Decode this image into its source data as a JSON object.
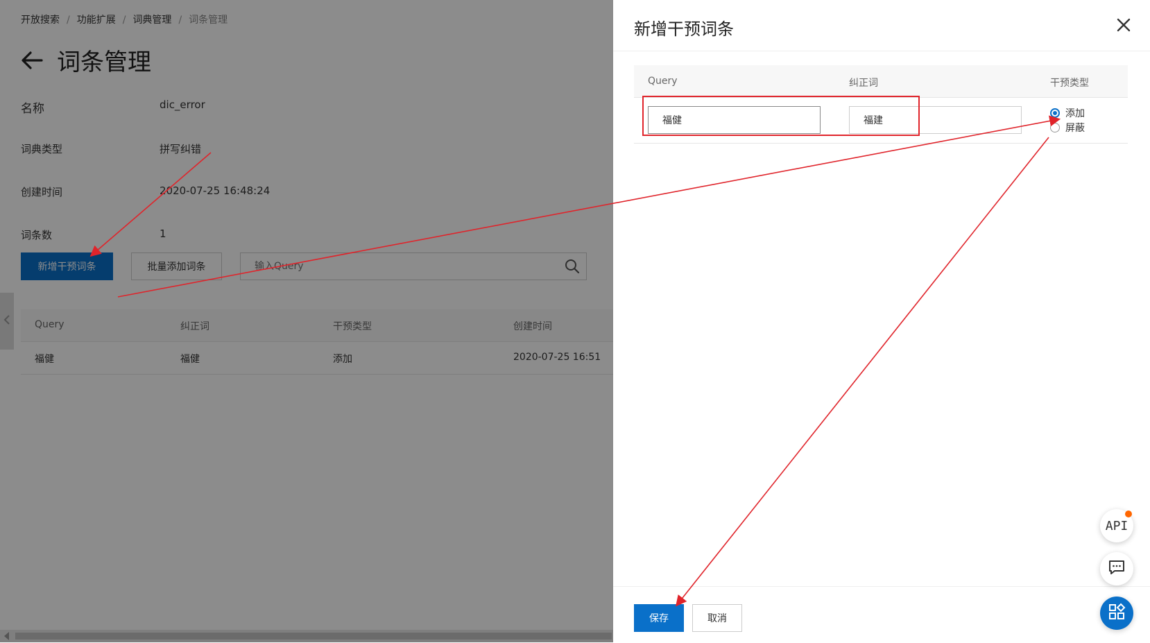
{
  "breadcrumb": [
    "开放搜索",
    "功能扩展",
    "词典管理",
    "词条管理"
  ],
  "page_title": "词条管理",
  "info": {
    "name_label": "名称",
    "name_value": "dic_error",
    "type_label": "词典类型",
    "type_value": "拼写纠错",
    "created_label": "创建时间",
    "created_value": "2020-07-25 16:48:24",
    "count_label": "词条数",
    "count_value": "1"
  },
  "toolbar": {
    "add_label": "新增干预词条",
    "batch_label": "批量添加词条",
    "search_placeholder": "输入Query"
  },
  "table": {
    "headers": [
      "Query",
      "纠正词",
      "干预类型",
      "创建时间"
    ],
    "rows": [
      [
        "福健",
        "福健",
        "添加",
        "2020-07-25 16:51"
      ]
    ]
  },
  "drawer": {
    "title": "新增干预词条",
    "headers": [
      "Query",
      "纠正词",
      "干预类型"
    ],
    "query_value": "福健",
    "correction_value": "福建",
    "radio_options": [
      "添加",
      "屏蔽"
    ],
    "selected": "添加",
    "save_label": "保存",
    "cancel_label": "取消"
  },
  "float": {
    "api_label": "API"
  },
  "colors": {
    "primary": "#0a70c9",
    "annotation": "#e0242b",
    "badge": "#ff6600"
  },
  "icons": [
    "back-arrow-icon",
    "search-icon",
    "close-icon",
    "chevron-left-icon",
    "chat-icon",
    "apps-icon"
  ]
}
